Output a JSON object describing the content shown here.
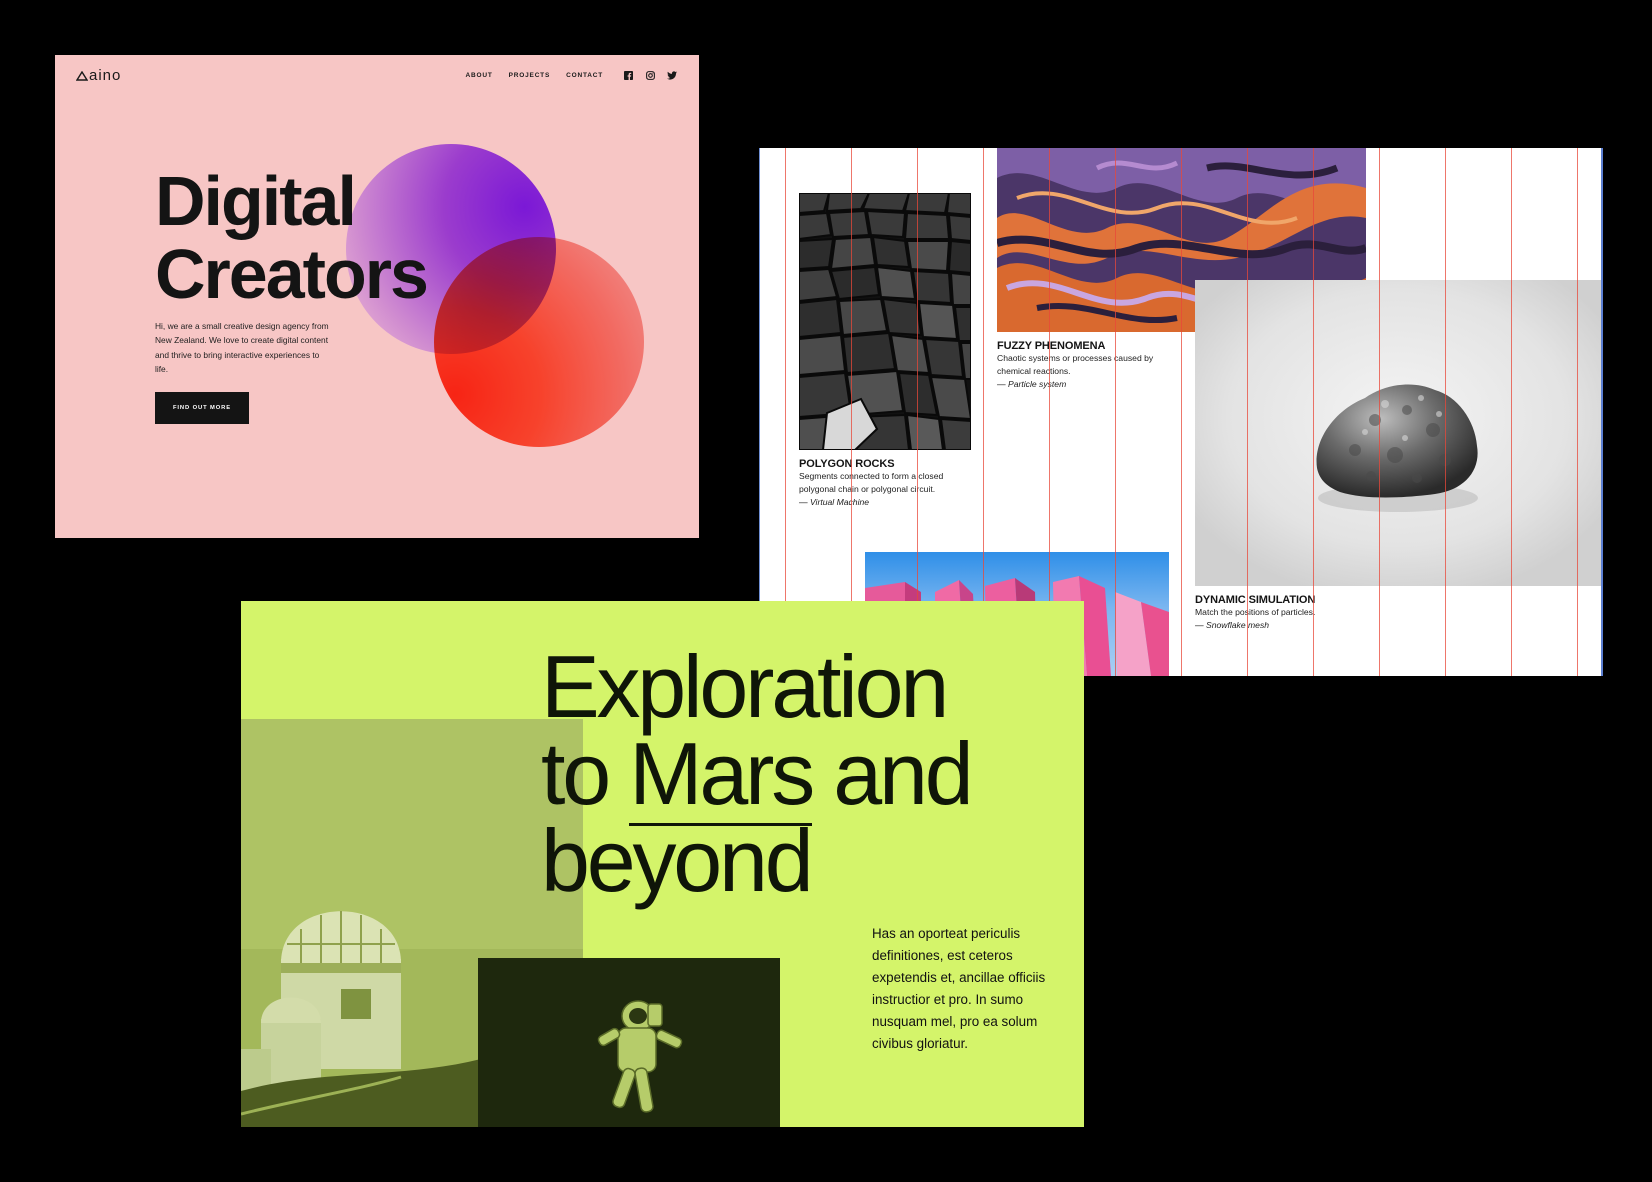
{
  "pink_card": {
    "logo": "aino",
    "nav": {
      "about": "ABOUT",
      "projects": "PROJECTS",
      "contact": "CONTACT"
    },
    "social_icons": [
      "facebook-icon",
      "instagram-icon",
      "twitter-icon"
    ],
    "hero_title_line1": "Digital",
    "hero_title_line2": "Creators",
    "hero_text": "Hi, we are a small creative design agency from New Zealand. We love to create digital content and thrive to bring interactive experiences to life.",
    "cta_label": "FIND OUT MORE",
    "colors": {
      "background": "#f7c6c5",
      "purple": "#7b18d6",
      "red": "#ff2e1a"
    }
  },
  "grid_card": {
    "items": [
      {
        "title": "POLYGON ROCKS",
        "text": "Segments connected to form a closed polygonal chain or polygonal circuit.",
        "credit": "— Virtual Machine"
      },
      {
        "title": "FUZZY PHENOMENA",
        "text": "Chaotic systems or processes caused by chemical reactions.",
        "credit": "— Particle system"
      },
      {
        "title": "DYNAMIC SIMULATION",
        "text": "Match the positions of particles.",
        "credit": "— Snowflake mesh"
      }
    ],
    "colors": {
      "gridline": "#e8483a"
    }
  },
  "green_card": {
    "title_line1": "Exploration",
    "title_line2_prefix": "to ",
    "title_line2_underlined": "Mars",
    "title_line2_suffix": " and",
    "title_line3": "beyond",
    "body_text": "Has an oporteat periculis definitiones, est ceteros expetendis et, ancillae officiis instructior et pro. In sumo nusquam mel, pro ea solum civibus gloriatur.",
    "colors": {
      "background": "#d4f46a"
    }
  }
}
